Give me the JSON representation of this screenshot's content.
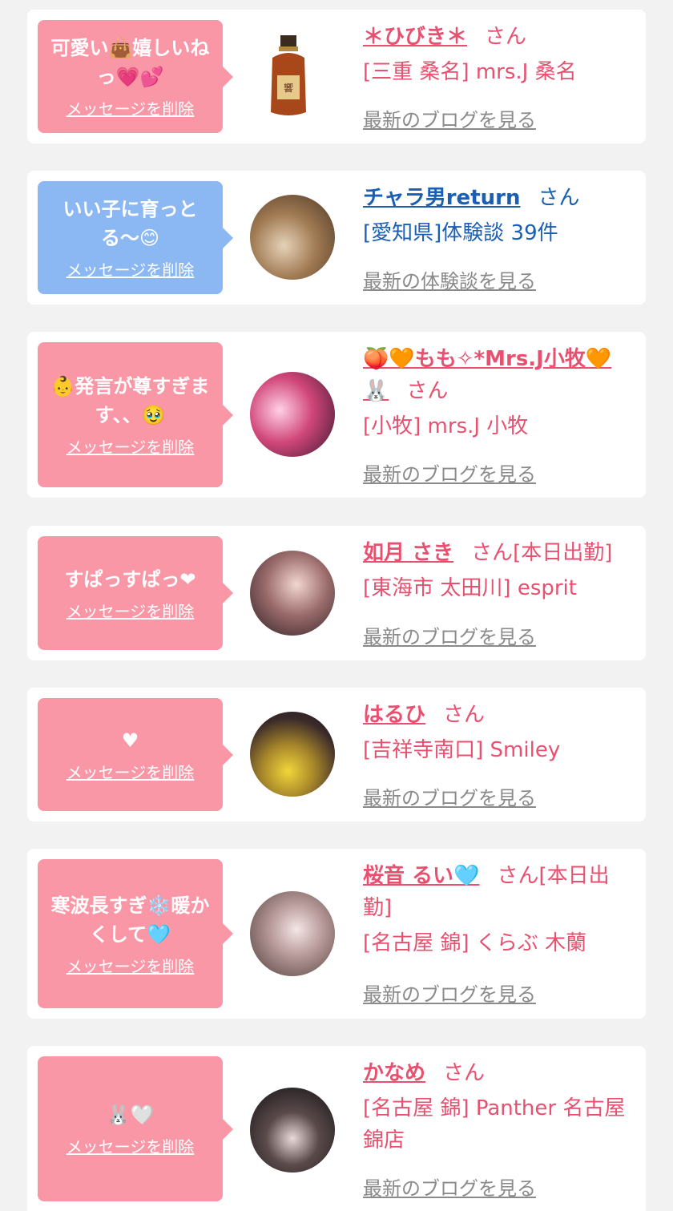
{
  "colors": {
    "pink_text": "#e8506f",
    "blue_text": "#1a5fb4",
    "pink_bubble": "#f997a6",
    "blue_bubble": "#8bb8f3",
    "gray_link": "#8a8a8a"
  },
  "delete_label": "メッセージを削除",
  "san_suffix": "さん",
  "items": [
    {
      "message": "可愛い👜嬉しいねっ💗💕",
      "name": "＊ひびき＊",
      "status": "",
      "shop": "[三重 桑名] mrs.J 桑名",
      "link": "最新のブログを見る",
      "bubble_color": "pink",
      "avatar": "whisky-bottle"
    },
    {
      "message": "いい子に育っとる〜😊",
      "name": "チャラ男return",
      "status": "",
      "shop": "[愛知県]体験談 39件",
      "link": "最新の体験談を見る",
      "bubble_color": "blue",
      "avatar": "food-photo"
    },
    {
      "message": "👶発言が尊すぎます、、🥹",
      "name": "🍑🧡もも✧*Mrs.J小牧🧡🐰",
      "status": "",
      "shop": "[小牧] mrs.J 小牧",
      "link": "最新のブログを見る",
      "bubble_color": "pink",
      "avatar": "pink-light-photo"
    },
    {
      "message": "すぱっすぱっ❤",
      "name": "如月 さき",
      "status": "[本日出勤]",
      "shop": "[東海市 太田川] esprit",
      "link": "最新のブログを見る",
      "bubble_color": "pink",
      "avatar": "portrait-photo"
    },
    {
      "message": "♥",
      "name": "はるひ",
      "status": "",
      "shop": "[吉祥寺南口] Smiley",
      "link": "最新のブログを見る",
      "bubble_color": "pink",
      "avatar": "yellow-shirt-photo"
    },
    {
      "message": "寒波長すぎ❄️暖かくして🩵",
      "name": "桜音 るい🩵",
      "status": "[本日出勤]",
      "shop": "[名古屋 錦] くらぶ 木蘭",
      "link": "最新のブログを見る",
      "bubble_color": "pink",
      "avatar": "portrait-photo-2"
    },
    {
      "message": "🐰🤍",
      "name": "かなめ",
      "status": "",
      "shop": "[名古屋 錦] Panther 名古屋錦店",
      "link": "最新のブログを見る",
      "bubble_color": "pink",
      "avatar": "panther-photo"
    }
  ]
}
